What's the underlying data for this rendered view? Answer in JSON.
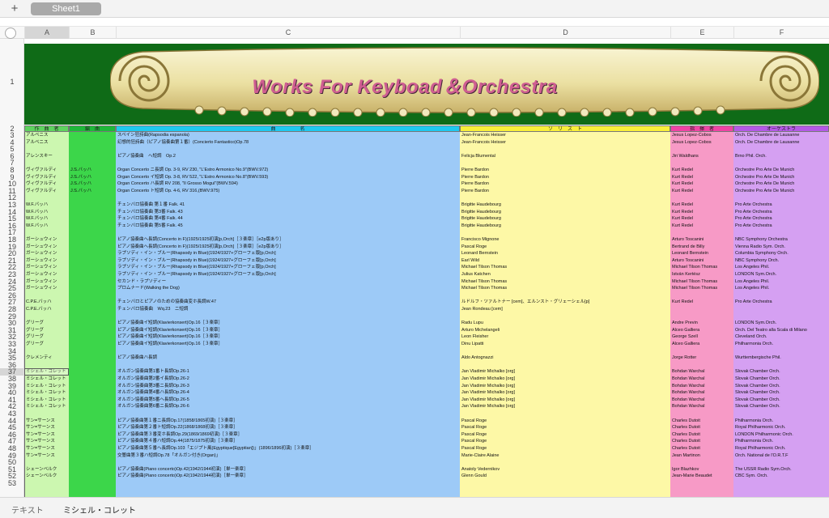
{
  "sheet_tab": "Sheet1",
  "add_sheet": "+",
  "columns": [
    "A",
    "B",
    "C",
    "D",
    "E",
    "F"
  ],
  "banner_title": "Works  For  Keyboad＆Orchestra",
  "headers": {
    "composer": "作　曲　者",
    "arranger": "編　曲",
    "title": "曲　　　　　名",
    "soloist": "ソ　リ　ス　ト",
    "conductor": "指　揮　者",
    "orchestra": "オーケストラ"
  },
  "rows": [
    {
      "n": "3",
      "a": "アルベニス",
      "b": "",
      "c": "スペイン狂詩曲(Rapsodia espanola)",
      "d": "Jean-Francois Heisser",
      "e": "Jesus Lopez-Cobos",
      "f": "Orch. De Chambre de Lausanne"
    },
    {
      "n": "4",
      "a": "アルベニス",
      "b": "",
      "c": "幻想的狂詩曲（ピアノ協奏曲第１番）(Concierto Fantastico)Op.78",
      "d": "Jean-Francois Heisser",
      "e": "Jesus Lopez-Cobos",
      "f": "Orch. De Chambre de Lausanne"
    },
    {
      "n": "5",
      "a": "",
      "b": "",
      "c": "",
      "d": "",
      "e": "",
      "f": ""
    },
    {
      "n": "6",
      "a": "アレンスキー",
      "b": "",
      "c": "ピアノ協奏曲　ヘ短調　Op.2",
      "d": "Felicja Blumental",
      "e": "Jiri Waldhans",
      "f": "Brno Phil. Orch."
    },
    {
      "n": "7",
      "a": "",
      "b": "",
      "c": "",
      "d": "",
      "e": "",
      "f": ""
    },
    {
      "n": "8",
      "a": "ヴィヴァルディ",
      "b": "J.S.バッハ",
      "c": "Organ Concerto ニ長調 Op. 3-9, RV 230, \"L'Estro Armonico No.9\"(BWV.972)",
      "d": "Pierre Bardon",
      "e": "Kurt Redel",
      "f": "Orchestre Pro Arte De Munich"
    },
    {
      "n": "9",
      "a": "ヴィヴァルディ",
      "b": "J.S.バッハ",
      "c": "Organ Concerto イ短調 Op. 3-8, RV 522, \"L'Estro Armonico No.8\"(BWV.593)",
      "d": "Pierre Bardon",
      "e": "Kurt Redel",
      "f": "Orchestre Pro Arte De Munich"
    },
    {
      "n": "10",
      "a": "ヴィヴァルディ",
      "b": "J.S.バッハ",
      "c": "Organ Concerto ハ長調 RV 208, \"Il Grosso Mogul\"(BWV.594)",
      "d": "Pierre Bardon",
      "e": "Kurt Redel",
      "f": "Orchestre Pro Arte De Munich"
    },
    {
      "n": "11",
      "a": "ヴィヴァルディ",
      "b": "J.S.バッハ",
      "c": "Organ Concerto ト短調 Op. 4-6, RV 316,(BWV.975)",
      "d": "Pierre Bardon",
      "e": "Kurt Redel",
      "f": "Orchestre Pro Arte De Munich"
    },
    {
      "n": "12",
      "a": "",
      "b": "",
      "c": "",
      "d": "",
      "e": "",
      "f": ""
    },
    {
      "n": "13",
      "a": "W.F.バッハ",
      "b": "",
      "c": "チェンバロ協奏曲 第１番 Falk. 41",
      "d": "Brigitte Haudebourg",
      "e": "Kurt Redel",
      "f": "Pro Arte Orchestra"
    },
    {
      "n": "14",
      "a": "W.F.バッハ",
      "b": "",
      "c": "チェンバロ協奏曲 第3番 Falk. 43",
      "d": "Brigitte Haudebourg",
      "e": "Kurt Redel",
      "f": "Pro Arte Orchestra"
    },
    {
      "n": "15",
      "a": "W.F.バッハ",
      "b": "",
      "c": "チェンバロ協奏曲 第4番 Falk. 44",
      "d": "Brigitte Haudebourg",
      "e": "Kurt Redel",
      "f": "Pro Arte Orchestra"
    },
    {
      "n": "16",
      "a": "W.F.バッハ",
      "b": "",
      "c": "チェンバロ協奏曲 第5番 Falk. 45",
      "d": "Brigitte Haudebourg",
      "e": "Kurt Redel",
      "f": "Pro Arte Orchestra"
    },
    {
      "n": "17",
      "a": "",
      "b": "",
      "c": "",
      "d": "",
      "e": "",
      "f": ""
    },
    {
      "n": "18",
      "a": "ガーシュウィン",
      "b": "",
      "c": "ピアノ協奏曲ヘ長調(Concerto in F)(1925/1925初演[p,Orch]［３楽章］［e2p版あり］",
      "d": "Francisco Mignone",
      "e": "Arturo Toscanini",
      "f": "NBC Symphony Orchestra"
    },
    {
      "n": "19",
      "a": "ガーシュウィン",
      "b": "",
      "c": "ピアノ協奏曲ヘ長調(Concerto in F)(1925/1925初演[p,Orch]［３楽章］［e2p版あり］",
      "d": "Pascal Roge",
      "e": "Bertrand de Billy",
      "f": "Vienna Radio Sym. Orch."
    },
    {
      "n": "20",
      "a": "ガーシュウィン",
      "b": "",
      "c": "ラプソディ・イン・ブルー(Rhapsody in Blue)(1924/1927+グローフェ版[p,Orch]",
      "d": "Leonard Bernstein",
      "e": "Leonard Bernstein",
      "f": "Columbia Symphony Orch."
    },
    {
      "n": "21",
      "a": "ガーシュウィン",
      "b": "",
      "c": "ラプソディ・イン・ブルー(Rhapsody in Blue)(1924/1927+グローフェ版[p,Orch]",
      "d": "Earl Wild",
      "e": "Arturo Toscanini",
      "f": "NBC Symphony Orch."
    },
    {
      "n": "22",
      "a": "ガーシュウィン",
      "b": "",
      "c": "ラプソディ・イン・ブルー(Rhapsody in Blue)(1924/1927+グローフェ版[p,Orch]",
      "d": "Michael Tilson Thomas",
      "e": "Michael Tilson Thomas",
      "f": "Los Angeles Phil."
    },
    {
      "n": "23",
      "a": "ガーシュウィン",
      "b": "",
      "c": "ラプソディ・イン・ブルー(Rhapsody in Blue)(1924/1927+グローフェ版[p,Orch]",
      "d": "Julius Katchen",
      "e": "István Kertész",
      "f": "LONDON Sym.Orch."
    },
    {
      "n": "24",
      "a": "ガーシュウィン",
      "b": "",
      "c": "セカンド・ラプソディー",
      "d": "Michael Tilson Thomas",
      "e": "Michael Tilson Thomas",
      "f": "Los Angeles Phil."
    },
    {
      "n": "25",
      "a": "ガーシュウィン",
      "b": "",
      "c": "プロムナード(Walking the Dog)",
      "d": "Michael Tilson Thomas",
      "e": "Michael Tilson Thomas",
      "f": "Los Angeles Phil."
    },
    {
      "n": "26",
      "a": "",
      "b": "",
      "c": "",
      "d": "",
      "e": "",
      "f": ""
    },
    {
      "n": "27",
      "a": "C.P.E.バッハ",
      "b": "",
      "c": "チェンバロとピアノのための協奏曲変ホ長調W.47",
      "d": "ルドルフ・ツァルトナー [cem]、エルンスト・グリェーシェル[p]",
      "e": "Kurt Redel",
      "f": "Pro Arte Orchestra"
    },
    {
      "n": "28",
      "a": "C.P.E.バッハ",
      "b": "",
      "c": "チェンバロ協奏曲　Wq.23　ニ短調",
      "d": "Jean Rondeau [cem]",
      "e": "",
      "f": ""
    },
    {
      "n": "29",
      "a": "",
      "b": "",
      "c": "",
      "d": "",
      "e": "",
      "f": ""
    },
    {
      "n": "30",
      "a": "グリーグ",
      "b": "",
      "c": "ピアノ協奏曲イ短調(Klavierkonsert)Op.16［３楽章］",
      "d": "Radu Lupu",
      "e": "Andre Previn",
      "f": "LONDON Sym.Orch."
    },
    {
      "n": "31",
      "a": "グリーグ",
      "b": "",
      "c": "ピアノ協奏曲イ短調(Klavierkonsert)Op.16［３楽章］",
      "d": "Arturo Michelangeli",
      "e": "Alceo Galliera",
      "f": "Orch. Del Teatro alla Scala di Milano"
    },
    {
      "n": "32",
      "a": "グリーグ",
      "b": "",
      "c": "ピアノ協奏曲イ短調(Klavierkonsert)Op.16［３楽章］",
      "d": "Leon Fleisher",
      "e": "George Szell",
      "f": "Cleveland Orch."
    },
    {
      "n": "33",
      "a": "グリーグ",
      "b": "",
      "c": "ピアノ協奏曲イ短調(Klavierkonsert)Op.16［３楽章］",
      "d": "Dinu Lipatti",
      "e": "Alceo Galliera",
      "f": "Philharmonia Orch."
    },
    {
      "n": "34",
      "a": "",
      "b": "",
      "c": "",
      "d": "",
      "e": "",
      "f": ""
    },
    {
      "n": "35",
      "a": "クレメンティ",
      "b": "",
      "c": "ピアノ協奏曲ハ長調",
      "d": "Aldo Antognazzi",
      "e": "Jorge Rotter",
      "f": "Wurttembergische Phil."
    },
    {
      "n": "36",
      "a": "",
      "b": "",
      "c": "",
      "d": "",
      "e": "",
      "f": ""
    },
    {
      "n": "37",
      "a": "ミシェル・コレット",
      "b": "",
      "c": "オルガン協奏曲第1番ト長調Op.26-1",
      "d": "Jan Vladimir Michalko [org]",
      "e": "Bohdan Warchal",
      "f": "Slovak Chamber Orch."
    },
    {
      "n": "38",
      "a": "ミシェル・コレット",
      "b": "",
      "c": "オルガン協奏曲第2番イ長調Op.26-2",
      "d": "Jan Vladimir Michalko [org]",
      "e": "Bohdan Warchal",
      "f": "Slovak Chamber Orch."
    },
    {
      "n": "39",
      "a": "ミシェル・コレット",
      "b": "",
      "c": "オルガン協奏曲第3番ニ長調Op.26-3",
      "d": "Jan Vladimir Michalko [org]",
      "e": "Bohdan Warchal",
      "f": "Slovak Chamber Orch."
    },
    {
      "n": "40",
      "a": "ミシェル・コレット",
      "b": "",
      "c": "オルガン協奏曲第4番ハ長調Op.26-4",
      "d": "Jan Vladimir Michalko [org]",
      "e": "Bohdan Warchal",
      "f": "Slovak Chamber Orch."
    },
    {
      "n": "41",
      "a": "ミシェル・コレット",
      "b": "",
      "c": "オルガン協奏曲第5番ヘ長調Op.26-5",
      "d": "Jan Vladimir Michalko [org]",
      "e": "Bohdan Warchal",
      "f": "Slovak Chamber Orch."
    },
    {
      "n": "42",
      "a": "ミシェル・コレット",
      "b": "",
      "c": "オルガン協奏曲第6番ニ長調Op.26-6",
      "d": "Jan Vladimir Michalko [org]",
      "e": "Bohdan Warchal",
      "f": "Slovak Chamber Orch."
    },
    {
      "n": "43",
      "a": "",
      "b": "",
      "c": "",
      "d": "",
      "e": "",
      "f": ""
    },
    {
      "n": "44",
      "a": "サン=サーンス",
      "b": "",
      "c": "ピアノ協奏曲第１番ニ長調Op.17(1858/1865初演)［３楽章］",
      "d": "Pascal Roge",
      "e": "Charles Dutoit",
      "f": "Philharmonia Orch."
    },
    {
      "n": "45",
      "a": "サン=サーンス",
      "b": "",
      "c": "ピアノ協奏曲第２番ト短調Op.22(1868/1868初演)［３楽章］",
      "d": "Pascal Roge",
      "e": "Charles Dutoit",
      "f": "Royal Philharmonic Orch."
    },
    {
      "n": "46",
      "a": "サン=サーンス",
      "b": "",
      "c": "ピアノ協奏曲第３番変ホ長調Op.29(1869/1869初演)［３楽章］",
      "d": "Pascal Roge",
      "e": "Charles Dutoit",
      "f": "LONDON  Philharmonic Orch."
    },
    {
      "n": "47",
      "a": "サン=サーンス",
      "b": "",
      "c": "ピアノ協奏曲第４番ハ短調Op.44(1875/1875初演)［３楽章］",
      "d": "Pascal Roge",
      "e": "Charles Dutoit",
      "f": "Philharmonia Orch."
    },
    {
      "n": "48",
      "a": "サン=サーンス",
      "b": "",
      "c": "ピアノ協奏曲第５番ヘ長調Op.103「エジプト風(Egyptique[Egyptian])」(1896/1896初演)［３楽章］",
      "d": "Pascal Roge",
      "e": "Charles Dutoit",
      "f": "Royal Philharmonic Orch."
    },
    {
      "n": "49",
      "a": "サン=サーンス",
      "b": "",
      "c": "交響曲第３番ハ短調Op.78「オルガン付き(Organ)」",
      "d": "Marie-Claire Alaine",
      "e": "Jean Martinon",
      "f": "Orch. National de l'O.R.T.F"
    },
    {
      "n": "50",
      "a": "",
      "b": "",
      "c": "",
      "d": "",
      "e": "",
      "f": ""
    },
    {
      "n": "51",
      "a": "シェーンベルク",
      "b": "",
      "c": "ピアノ協奏曲(Piano concerto)Op.42(1942/1944初演)［単一楽章］",
      "d": "Anatoly Vedernikov",
      "e": "Igor Blazhkov",
      "f": "The USSR Radio Sym.Orch."
    },
    {
      "n": "52",
      "a": "シェーンベルク",
      "b": "",
      "c": "ピアノ協奏曲(Piano concerto)Op.42(1942/1944初演)［単一楽章］",
      "d": "Glenn Gould",
      "e": "Jean-Marie Beaudet",
      "f": "CBC Sym. Orch."
    },
    {
      "n": "53",
      "a": "",
      "b": "",
      "c": "",
      "d": "",
      "e": "",
      "f": ""
    }
  ],
  "status": {
    "label": "テキスト",
    "value": "ミシェル・コレット"
  },
  "colors": {
    "banner": "#0f6b17",
    "composer": "#ccf7b0",
    "arranger": "#3cd64a",
    "title": "#9dcaf7",
    "soloist": "#fdf8a6",
    "conductor": "#f79ac6",
    "orchestra": "#d5a0f2"
  }
}
